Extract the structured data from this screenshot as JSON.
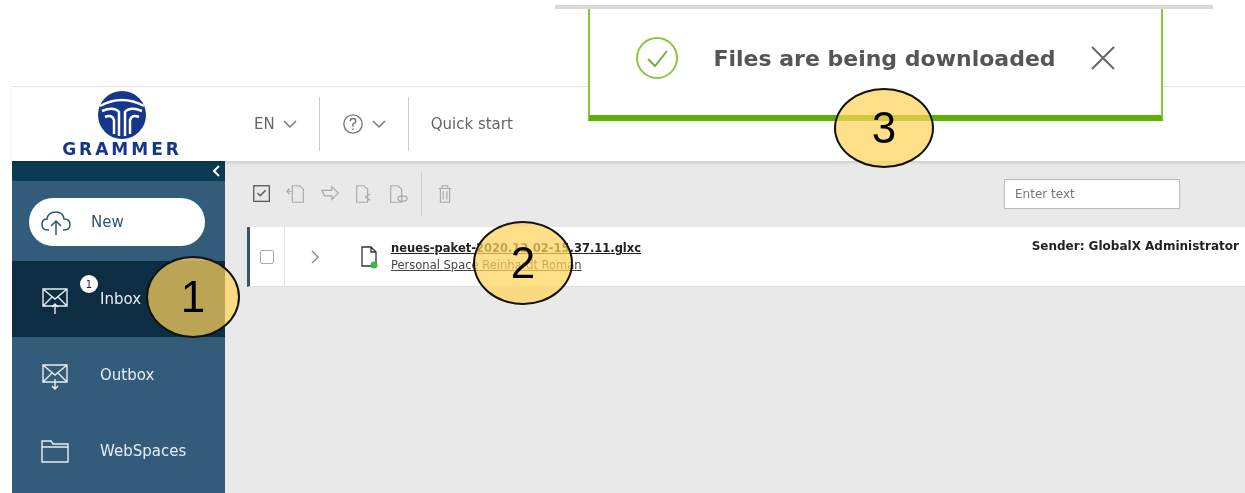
{
  "toast": {
    "message": "Files are being downloaded"
  },
  "logo": {
    "text": "GRAMMER"
  },
  "header": {
    "language": "EN",
    "quick_start": "Quick start"
  },
  "sidebar": {
    "new_button": "New",
    "items": [
      {
        "kind": "inbox",
        "label": "Inbox",
        "badge": "1",
        "selected": true
      },
      {
        "kind": "outbox",
        "label": "Outbox",
        "selected": false
      },
      {
        "kind": "folder",
        "label": "WebSpaces",
        "selected": false
      }
    ]
  },
  "toolbar": {
    "search": {
      "placeholder": "Enter text"
    }
  },
  "packages": [
    {
      "name": "neues-paket-2020.12.02-15.37.11.glxc",
      "location": "Personal Space Reinhardt Roman",
      "sender": "Sender: GlobalX Administrator",
      "checked": false
    }
  ],
  "annotations": [
    {
      "label": "1"
    },
    {
      "label": "2"
    },
    {
      "label": "3"
    }
  ]
}
